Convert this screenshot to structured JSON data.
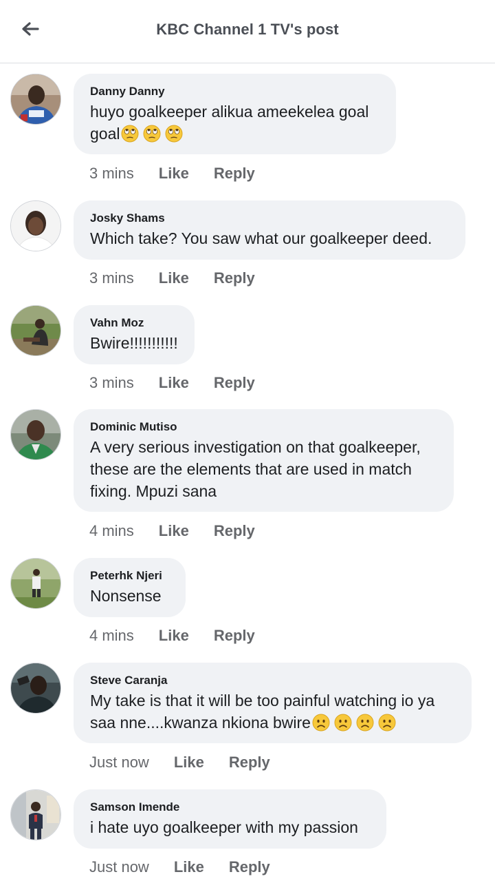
{
  "header": {
    "title": "KBC Channel 1 TV's post",
    "back_icon": "arrow-left-icon"
  },
  "actions": {
    "like_label": "Like",
    "reply_label": "Reply"
  },
  "comments": [
    {
      "author": "Danny Danny",
      "text": "huyo goalkeeper alikua ameekelea goal goal",
      "emojis": [
        "eye-roll-emoji",
        "eye-roll-emoji",
        "eye-roll-emoji"
      ],
      "time": "3 mins"
    },
    {
      "author": "Josky Shams",
      "text": "Which take? You saw what our goalkeeper deed.",
      "emojis": [],
      "time": "3 mins"
    },
    {
      "author": "Vahn Moz",
      "text": "Bwire!!!!!!!!!!!",
      "emojis": [],
      "time": "3 mins"
    },
    {
      "author": "Dominic Mutiso",
      "text": "A very serious investigation on that goalkeeper, these are the elements that are used in match fixing. Mpuzi sana",
      "emojis": [],
      "time": "4 mins"
    },
    {
      "author": "Peterhk Njeri",
      "text": "Nonsense",
      "emojis": [],
      "time": "4 mins"
    },
    {
      "author": "Steve Caranja",
      "text": "My take is that it will be too painful watching io ya saa nne....kwanza nkiona bwire",
      "emojis": [
        "frowning-emoji",
        "frowning-emoji",
        "frowning-emoji",
        "frowning-emoji"
      ],
      "time": "Just now"
    },
    {
      "author": "Samson Imende",
      "text": "i hate uyo goalkeeper with my passion",
      "emojis": [],
      "time": "Just now"
    }
  ],
  "colors": {
    "bubble": "#f0f2f5",
    "meta_text": "#65676b",
    "header_text": "#4b4f56",
    "emoji_face": "#f7c83b"
  }
}
